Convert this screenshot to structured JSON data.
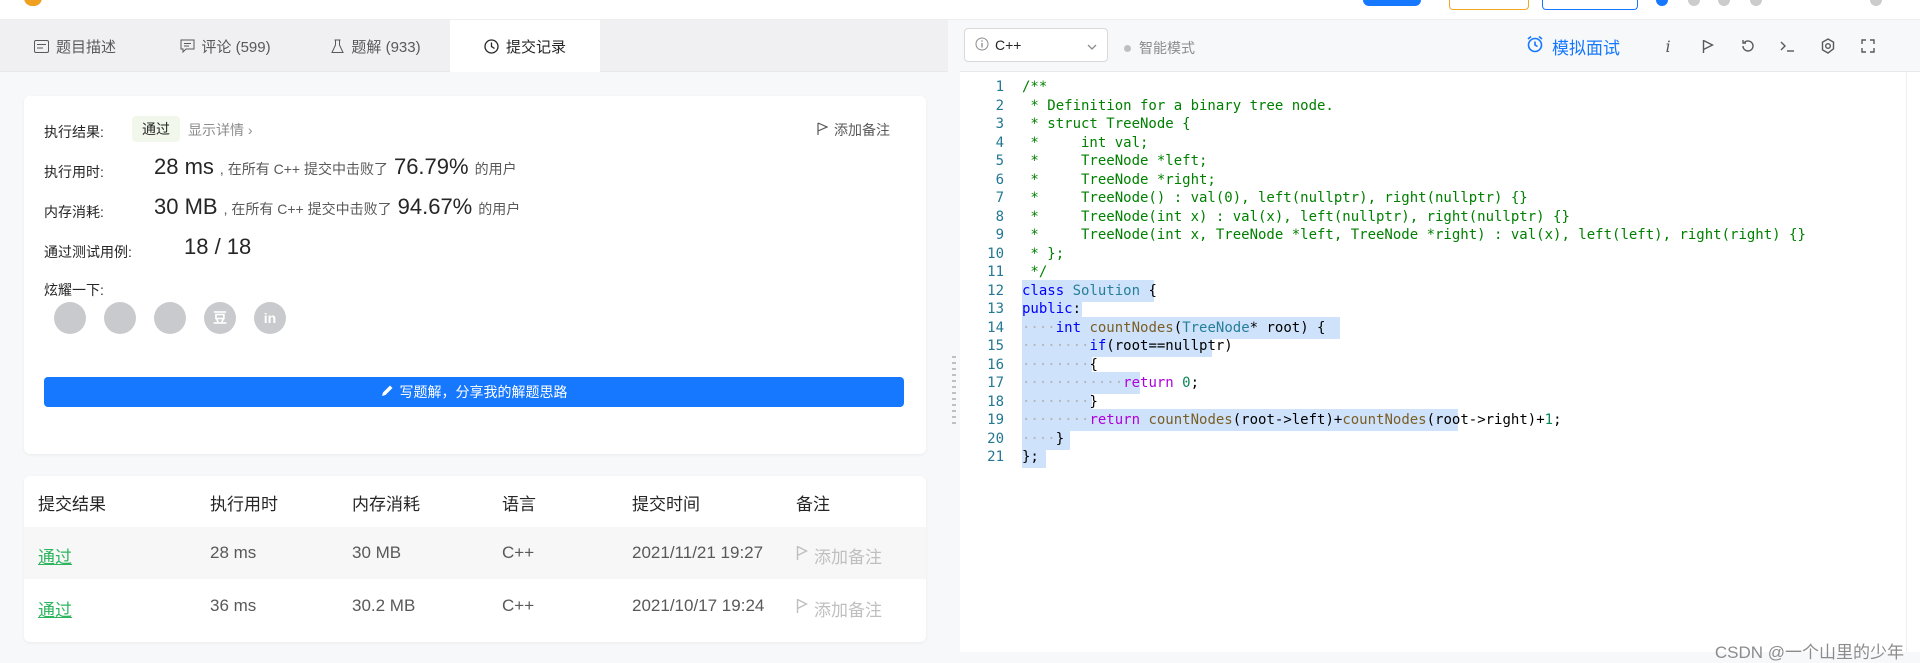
{
  "left_tabs": [
    {
      "label": "题目描述",
      "icon": "description-icon"
    },
    {
      "label": "评论 (599)",
      "icon": "comment-icon"
    },
    {
      "label": "题解 (933)",
      "icon": "flask-icon"
    },
    {
      "label": "提交记录",
      "icon": "clock-icon"
    }
  ],
  "result": {
    "status_label": "执行结果:",
    "status_value": "通过",
    "detail_link": "显示详情 ›",
    "add_note": "添加备注",
    "runtime_label": "执行用时:",
    "runtime_value": "28 ms",
    "runtime_text": ", 在所有 C++ 提交中击败了",
    "runtime_percent": "76.79%",
    "runtime_suffix": "的用户",
    "memory_label": "内存消耗:",
    "memory_value": "30 MB",
    "memory_text": ", 在所有 C++ 提交中击败了",
    "memory_percent": "94.67%",
    "memory_suffix": "的用户",
    "tests_label": "通过测试用例:",
    "tests_value": "18 / 18",
    "share_label": "炫耀一下:",
    "share_icons": [
      "wechat-icon",
      "weibo-icon",
      "qq-icon",
      "douban-icon",
      "linkedin-icon"
    ],
    "share_glyphs": [
      "",
      "",
      "",
      "豆",
      "in"
    ],
    "write_button": "写题解，分享我的解题思路"
  },
  "table": {
    "headers": [
      "提交结果",
      "执行用时",
      "内存消耗",
      "语言",
      "提交时间",
      "备注"
    ],
    "rows": [
      {
        "result": "通过",
        "time": "28 ms",
        "memory": "30 MB",
        "lang": "C++",
        "date": "2021/11/21 19:27",
        "note": "添加备注"
      },
      {
        "result": "通过",
        "time": "36 ms",
        "memory": "30.2 MB",
        "lang": "C++",
        "date": "2021/10/17 19:24",
        "note": "添加备注"
      }
    ]
  },
  "editor_toolbar": {
    "language": "C++",
    "smart_mode": "智能模式",
    "mock_interview": "模拟面试"
  },
  "code_lines": [
    "/**",
    " * Definition for a binary tree node.",
    " * struct TreeNode {",
    " *     int val;",
    " *     TreeNode *left;",
    " *     TreeNode *right;",
    " *     TreeNode() : val(0), left(nullptr), right(nullptr) {}",
    " *     TreeNode(int x) : val(x), left(nullptr), right(nullptr) {}",
    " *     TreeNode(int x, TreeNode *left, TreeNode *right) : val(x), left(left), right(right) {}",
    " * };",
    " */",
    "class Solution {",
    "public:",
    "    int countNodes(TreeNode* root) {",
    "        if(root==nullptr)",
    "        {",
    "            return 0;",
    "        }",
    "        return countNodes(root->left)+countNodes(root->right)+1;",
    "    }",
    "};"
  ],
  "watermark": "CSDN @一个山里的少年"
}
